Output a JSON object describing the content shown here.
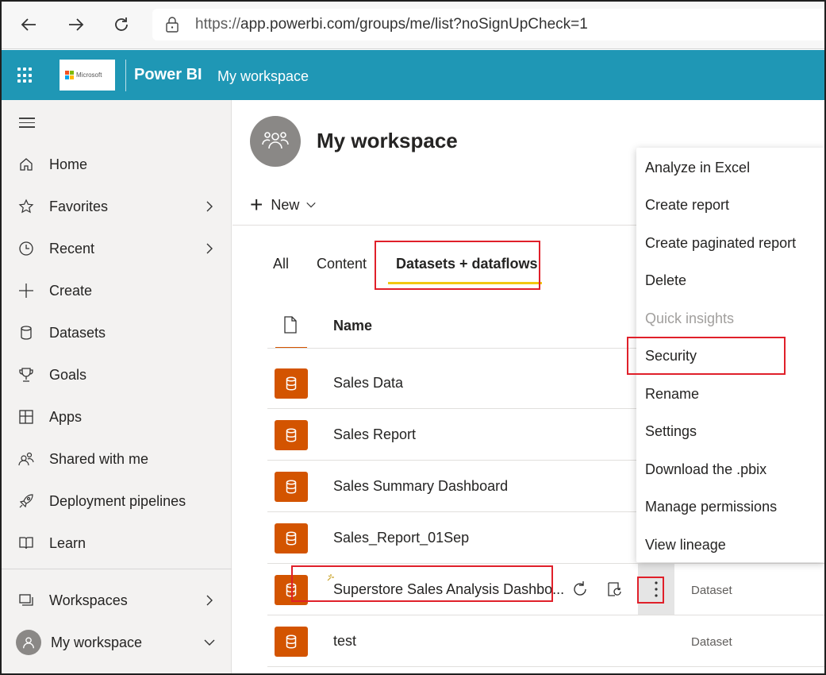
{
  "browser": {
    "url_prefix": "https://",
    "url_rest": "app.powerbi.com/groups/me/list?noSignUpCheck=1"
  },
  "header": {
    "brand_text": "Microsoft",
    "app_name": "Power BI",
    "workspace": "My workspace"
  },
  "sidebar": {
    "items": [
      {
        "label": "Home"
      },
      {
        "label": "Favorites"
      },
      {
        "label": "Recent"
      },
      {
        "label": "Create"
      },
      {
        "label": "Datasets"
      },
      {
        "label": "Goals"
      },
      {
        "label": "Apps"
      },
      {
        "label": "Shared with me"
      },
      {
        "label": "Deployment pipelines"
      },
      {
        "label": "Learn"
      }
    ],
    "workspaces": "Workspaces",
    "my_workspace": "My workspace"
  },
  "main": {
    "title": "My workspace",
    "new_label": "New",
    "tabs": [
      {
        "label": "All"
      },
      {
        "label": "Content"
      },
      {
        "label": "Datasets + dataflows"
      }
    ],
    "column_name": "Name",
    "rows": [
      {
        "name": "Sales Data",
        "type": ""
      },
      {
        "name": "Sales Report",
        "type": ""
      },
      {
        "name": "Sales Summary Dashboard",
        "type": ""
      },
      {
        "name": "Sales_Report_01Sep",
        "type": ""
      },
      {
        "name": "Superstore Sales Analysis Dashbo...",
        "type": "Dataset"
      },
      {
        "name": "test",
        "type": "Dataset"
      }
    ]
  },
  "menu": {
    "items": [
      {
        "label": "Analyze in Excel"
      },
      {
        "label": "Create report"
      },
      {
        "label": "Create paginated report"
      },
      {
        "label": "Delete"
      },
      {
        "label": "Quick insights"
      },
      {
        "label": "Security"
      },
      {
        "label": "Rename"
      },
      {
        "label": "Settings"
      },
      {
        "label": "Download the .pbix"
      },
      {
        "label": "Manage permissions"
      },
      {
        "label": "View lineage"
      }
    ]
  },
  "colors": {
    "header_bg": "#1f97b5",
    "dataset_icon": "#d35400",
    "tab_underline": "#f2c811",
    "highlight_box": "#e0202a"
  }
}
